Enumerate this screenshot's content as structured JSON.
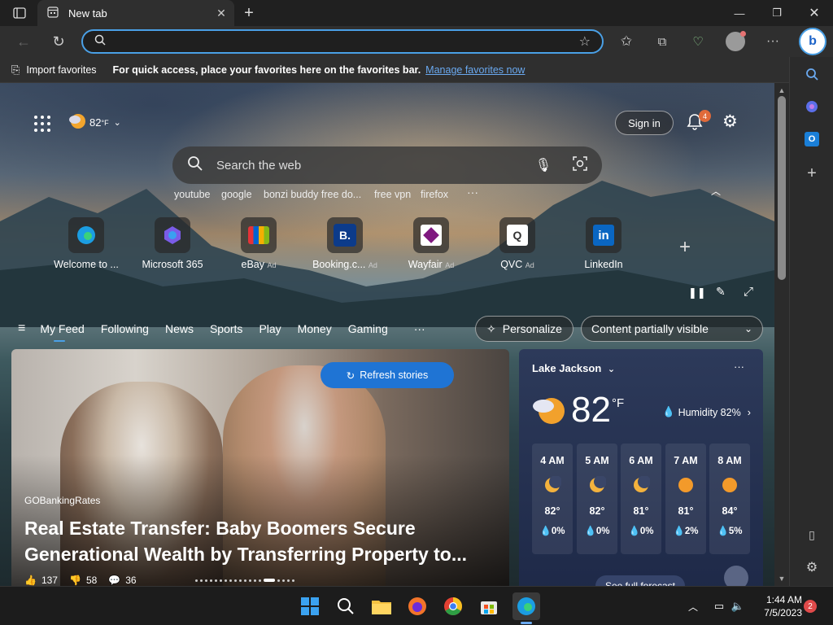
{
  "browser": {
    "tab_title": "New tab",
    "address_value": "",
    "favbar": {
      "import_label": "Import favorites",
      "message": "For quick access, place your favorites here on the favorites bar.",
      "manage_link": "Manage favorites now"
    }
  },
  "ntp": {
    "weather_temp": "82",
    "weather_unit": "°F",
    "sign_in": "Sign in",
    "notif_count": "4",
    "search_placeholder": "Search the web",
    "suggestions": [
      "youtube",
      "google",
      "bonzi buddy free do...",
      "free vpn",
      "firefox"
    ],
    "quick_links": [
      {
        "label": "Welcome to ...",
        "ad": ""
      },
      {
        "label": "Microsoft 365",
        "ad": ""
      },
      {
        "label": "eBay",
        "ad": "Ad"
      },
      {
        "label": "Booking.c...",
        "ad": "Ad"
      },
      {
        "label": "Wayfair",
        "ad": "Ad"
      },
      {
        "label": "QVC",
        "ad": "Ad"
      },
      {
        "label": "LinkedIn",
        "ad": ""
      }
    ],
    "feed_tabs": [
      "My Feed",
      "Following",
      "News",
      "Sports",
      "Play",
      "Money",
      "Gaming"
    ],
    "personalize": "Personalize",
    "content_visibility": "Content partially visible",
    "refresh": "Refresh stories",
    "story": {
      "source": "GOBankingRates",
      "headline_line1": "Real Estate Transfer: Baby Boomers Secure",
      "headline_line2": "Generational Wealth by Transferring Property to...",
      "likes": "137",
      "dislikes": "58",
      "comments": "36"
    },
    "weather_card": {
      "location": "Lake Jackson",
      "temp": "82",
      "unit": "°F",
      "humidity": "Humidity 82%",
      "hours": [
        {
          "time": "4 AM",
          "temp": "82°",
          "precip": "0%",
          "icon": "moon"
        },
        {
          "time": "5 AM",
          "temp": "82°",
          "precip": "0%",
          "icon": "moon"
        },
        {
          "time": "6 AM",
          "temp": "81°",
          "precip": "0%",
          "icon": "moon"
        },
        {
          "time": "7 AM",
          "temp": "81°",
          "precip": "2%",
          "icon": "sun"
        },
        {
          "time": "8 AM",
          "temp": "84°",
          "precip": "5%",
          "icon": "sun"
        }
      ],
      "full_forecast": "See full forecast"
    }
  },
  "taskbar": {
    "time": "1:44 AM",
    "date": "7/5/2023",
    "notif_count": "2"
  }
}
